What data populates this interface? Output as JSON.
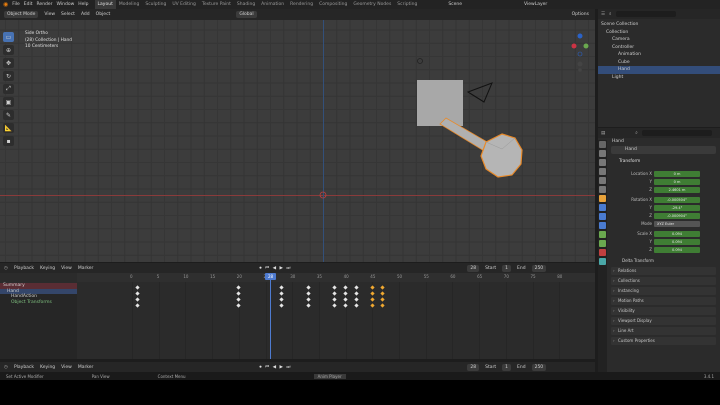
{
  "menu": [
    "File",
    "Edit",
    "Render",
    "Window",
    "Help"
  ],
  "workspaces": [
    "Layout",
    "Modeling",
    "Sculpting",
    "UV Editing",
    "Texture Paint",
    "Shading",
    "Animation",
    "Rendering",
    "Compositing",
    "Geometry Nodes",
    "Scripting"
  ],
  "scene": {
    "name": "Scene",
    "view_layer": "ViewLayer"
  },
  "viewport": {
    "mode": "Object Mode",
    "menus": [
      "View",
      "Select",
      "Add",
      "Object"
    ],
    "transform": "Global",
    "options": "Options",
    "info": [
      "Side Ortho",
      "(28) Collection | Hand",
      "10 Centimeters"
    ]
  },
  "timeline": {
    "menus": [
      "Playback",
      "Keying",
      "View",
      "Marker"
    ],
    "current_frame": "28",
    "start_label": "Start",
    "start": "1",
    "end_label": "End",
    "end": "250",
    "ticks": [
      "0",
      "5",
      "10",
      "15",
      "20",
      "25",
      "30",
      "35",
      "40",
      "45",
      "50",
      "55",
      "60",
      "65",
      "70",
      "75",
      "80"
    ],
    "channels": [
      "Summary",
      "Hand",
      "HandAction",
      "Object Transforms"
    ]
  },
  "footer": {
    "menus": [
      "Playback",
      "Keying",
      "View",
      "Marker"
    ],
    "frame": "28",
    "start_label": "Start",
    "start": "1",
    "end_label": "End",
    "end": "250"
  },
  "status": {
    "items": [
      "Set Active Modifier",
      "Pan View",
      "Context Menu",
      "Anim Player"
    ],
    "version": "3.4.1"
  },
  "outliner": {
    "items": [
      "Scene Collection",
      "Collection",
      "Camera",
      "Controller",
      "Animation",
      "Cube",
      "Hand",
      "Light"
    ]
  },
  "properties": {
    "object": "Hand",
    "object_field": "Hand",
    "transform": "Transform",
    "location_label": "Location X",
    "loc": [
      "0 m",
      "0 m",
      "2.4601 m"
    ],
    "rotation_label": "Rotation X",
    "rot": [
      "-0.000504°",
      "-29.4°",
      "-0.000904°"
    ],
    "mode_label": "Mode",
    "mode": "XYZ Euler",
    "scale_label": "Scale X",
    "scale": [
      "0.094",
      "0.094",
      "0.094"
    ],
    "axis_y": "Y",
    "axis_z": "Z",
    "delta": "Delta Transform",
    "panels": [
      "Relations",
      "Collections",
      "Instancing",
      "Motion Paths",
      "Visibility",
      "Viewport Display",
      "Line Art",
      "Custom Properties"
    ]
  }
}
